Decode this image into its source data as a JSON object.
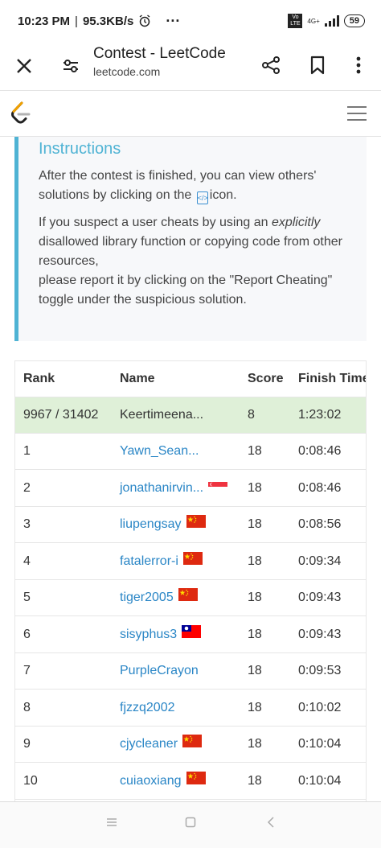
{
  "status": {
    "time": "10:23 PM",
    "speed": "95.3KB/s",
    "dots": "···",
    "volte": "Vo LTE",
    "network": "4G+",
    "battery": "59"
  },
  "toolbar": {
    "title": "Contest - LeetCode",
    "url": "leetcode.com"
  },
  "instructions": {
    "title": "Instructions",
    "p1_before": "After the contest is finished, you can view others' solutions by clicking on the",
    "p1_after": "icon.",
    "p2_a": "If you suspect a user cheats by using an",
    "p2_em": "explicitly",
    "p2_b": "disallowed library function or copying code from other resources,",
    "p2_c": "please report it by clicking on the \"Report Cheating\" toggle under the suspicious solution."
  },
  "table": {
    "headers": {
      "rank": "Rank",
      "name": "Name",
      "score": "Score",
      "time": "Finish Time"
    },
    "me": {
      "rank": "9967 / 31402",
      "name": "Keertimeena...",
      "score": "8",
      "time": "1:23:02"
    },
    "rows": [
      {
        "rank": "1",
        "name": "Yawn_Sean...",
        "score": "18",
        "time": "0:08:46",
        "flag": ""
      },
      {
        "rank": "2",
        "name": "jonathanirvin...",
        "score": "18",
        "time": "0:08:46",
        "flag": "sg"
      },
      {
        "rank": "3",
        "name": "liupengsay",
        "score": "18",
        "time": "0:08:56",
        "flag": "cn"
      },
      {
        "rank": "4",
        "name": "fatalerror-i",
        "score": "18",
        "time": "0:09:34",
        "flag": "cn"
      },
      {
        "rank": "5",
        "name": "tiger2005",
        "score": "18",
        "time": "0:09:43",
        "flag": "cn"
      },
      {
        "rank": "6",
        "name": "sisyphus3",
        "score": "18",
        "time": "0:09:43",
        "flag": "tw"
      },
      {
        "rank": "7",
        "name": "PurpleCrayon",
        "score": "18",
        "time": "0:09:53",
        "flag": ""
      },
      {
        "rank": "8",
        "name": "fjzzq2002",
        "score": "18",
        "time": "0:10:02",
        "flag": ""
      },
      {
        "rank": "9",
        "name": "cjycleaner",
        "score": "18",
        "time": "0:10:04",
        "flag": "cn"
      },
      {
        "rank": "10",
        "name": "cuiaoxiang",
        "score": "18",
        "time": "0:10:04",
        "flag": "cn"
      }
    ]
  },
  "colors": {
    "accent": "#4fb3d4",
    "link": "#2a86c6",
    "highlight": "#dff0d8"
  }
}
